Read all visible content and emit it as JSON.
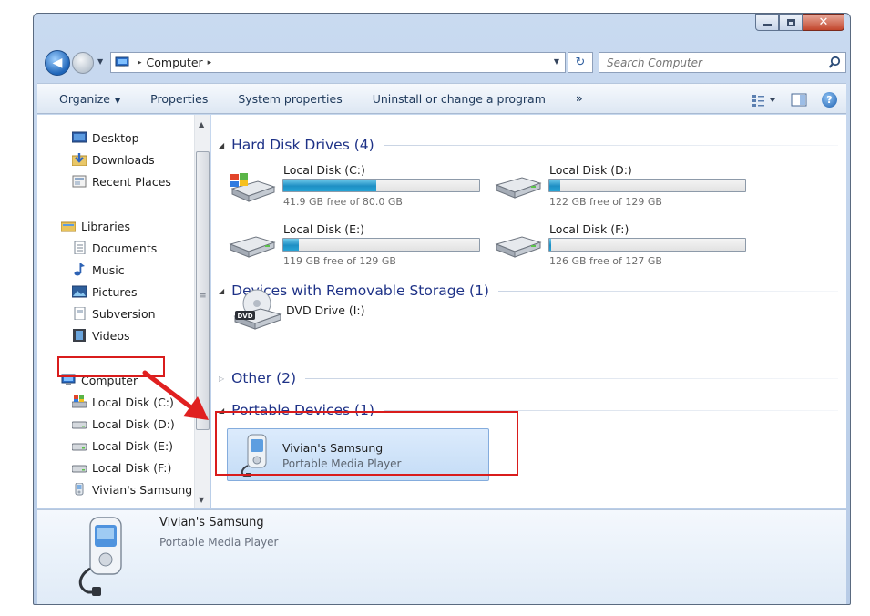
{
  "window": {
    "caption_buttons": [
      "minimize-icon",
      "maximize-icon",
      "close-icon"
    ]
  },
  "nav": {
    "breadcrumb_sep": "▸",
    "breadcrumb": "Computer",
    "search_placeholder": "Search Computer"
  },
  "toolbar": {
    "items": [
      "Organize",
      "Properties",
      "System properties",
      "Uninstall or change a program"
    ],
    "more": "»"
  },
  "sidebar": {
    "items": [
      {
        "label": "Desktop",
        "icon": "desktop-icon"
      },
      {
        "label": "Downloads",
        "icon": "downloads-icon"
      },
      {
        "label": "Recent Places",
        "icon": "recent-places-icon"
      },
      {
        "label": "Libraries",
        "icon": "libraries-icon"
      },
      {
        "label": "Documents",
        "icon": "documents-icon"
      },
      {
        "label": "Music",
        "icon": "music-icon"
      },
      {
        "label": "Pictures",
        "icon": "pictures-icon"
      },
      {
        "label": "Subversion",
        "icon": "subversion-icon"
      },
      {
        "label": "Videos",
        "icon": "videos-icon"
      },
      {
        "label": "Computer",
        "icon": "computer-icon"
      },
      {
        "label": "Local Disk (C:)",
        "icon": "disk-icon"
      },
      {
        "label": "Local Disk (D:)",
        "icon": "disk-icon"
      },
      {
        "label": "Local Disk (E:)",
        "icon": "disk-icon"
      },
      {
        "label": "Local Disk (F:)",
        "icon": "disk-icon"
      },
      {
        "label": "Vivian's Samsung",
        "icon": "media-player-icon"
      }
    ]
  },
  "groups": {
    "hard_disks": "Hard Disk Drives (4)",
    "removable": "Devices with Removable Storage (1)",
    "other": "Other (2)",
    "portable": "Portable Devices (1)"
  },
  "drives": [
    {
      "name": "Local Disk (C:)",
      "free": "41.9 GB free of 80.0 GB",
      "used_fraction": 0.476
    },
    {
      "name": "Local Disk (D:)",
      "free": "122 GB free of 129 GB",
      "used_fraction": 0.054
    },
    {
      "name": "Local Disk (E:)",
      "free": "119 GB free of 129 GB",
      "used_fraction": 0.078
    },
    {
      "name": "Local Disk (F:)",
      "free": "126 GB free of 127 GB",
      "used_fraction": 0.008
    }
  ],
  "dvd": {
    "name": "DVD Drive (I:)",
    "badge": "DVD"
  },
  "portable_device": {
    "name": "Vivian's Samsung",
    "type": "Portable Media Player"
  },
  "details": {
    "name": "Vivian's Samsung",
    "type": "Portable Media Player"
  },
  "colors": {
    "highlight": "#d91c1c",
    "group_title": "#1e3287",
    "bar_fill": "#1e8fc4"
  }
}
